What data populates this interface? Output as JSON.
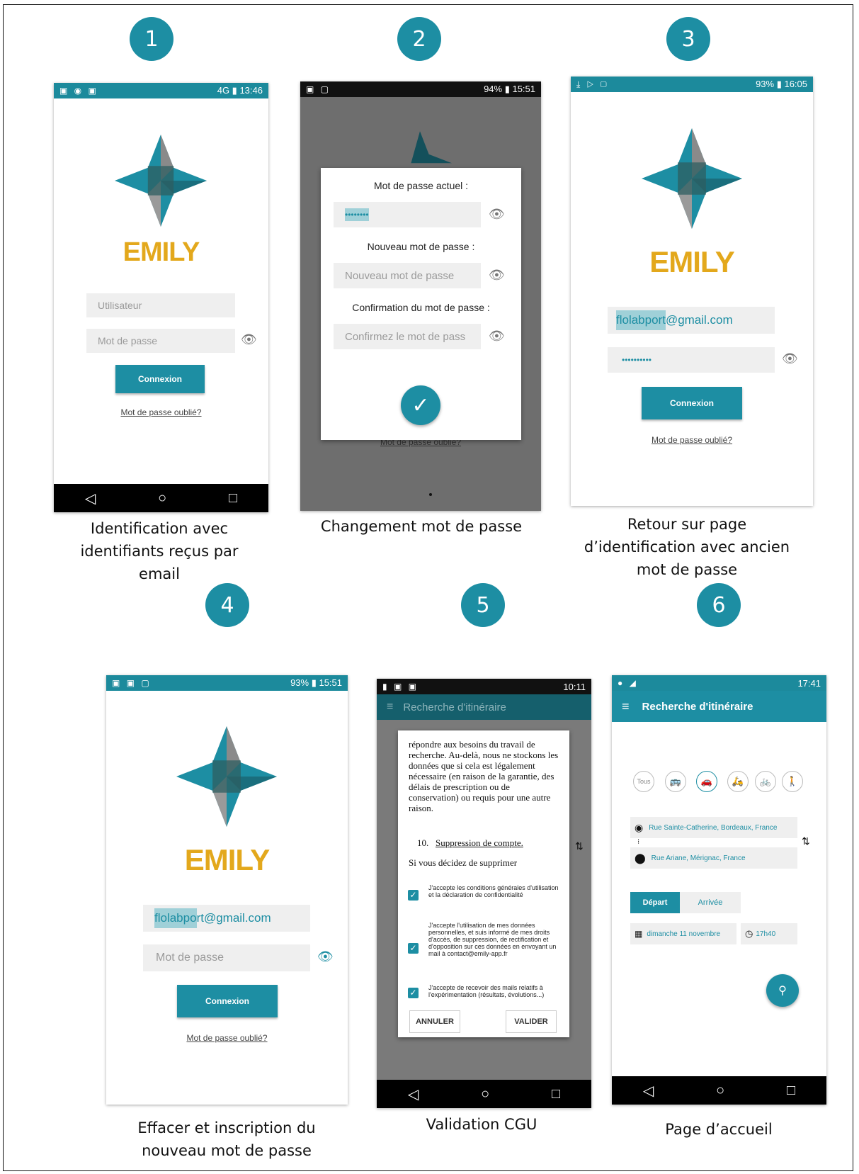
{
  "steps": [
    {
      "number": "1",
      "caption_lines": [
        "Identification avec",
        "identifiants reçus par",
        "email"
      ]
    },
    {
      "number": "2",
      "caption_lines": [
        "Changement mot de passe"
      ]
    },
    {
      "number": "3",
      "caption_lines": [
        "Retour sur page",
        "d’identification avec ancien",
        "mot de passe"
      ]
    },
    {
      "number": "4",
      "caption_lines": [
        "Effacer et inscription du",
        "nouveau mot de passe"
      ]
    },
    {
      "number": "5",
      "caption_lines": [
        "Validation CGU"
      ]
    },
    {
      "number": "6",
      "caption_lines": [
        "Page d’accueil"
      ]
    }
  ],
  "phone1": {
    "time": "13:46",
    "status_right": "4G ▮",
    "logo": "EMILY",
    "user_placeholder": "Utilisateur",
    "pass_placeholder": "Mot de passe",
    "login": "Connexion",
    "forgot": "Mot de passe oublié?"
  },
  "phone2": {
    "status": "94% ▮ 15:51",
    "current_label": "Mot de passe actuel :",
    "current_value": "••••••••",
    "new_label": "Nouveau mot de passe :",
    "new_placeholder": "Nouveau mot de passe",
    "confirm_label": "Confirmation du mot de passe :",
    "confirm_placeholder": "Confirmez le mot de pass",
    "forgot_behind": "Mot de passe oublié?"
  },
  "phone3": {
    "status": "93% ▮ 16:05",
    "logo": "EMILY",
    "email_hl": "flolabport",
    "email_rest": "@gmail.com",
    "password": "••••••••••",
    "login": "Connexion",
    "forgot": "Mot de passe oublié?"
  },
  "phone4": {
    "status": "93% ▮ 15:51",
    "logo": "EMILY",
    "email_hl": "flolabpo",
    "email_rest": "rt@gmail.com",
    "pass_placeholder": "Mot de passe",
    "login": "Connexion",
    "forgot": "Mot de passe oublié?"
  },
  "phone5": {
    "time": "10:11",
    "app_title": "Recherche d'itinéraire",
    "cgu_text": "répondre aux besoins du travail de recherche. Au-delà, nous ne stockons les données que si cela est légalement nécessaire (en raison de la garantie, des délais de prescription ou de conservation) ou requis pour une autre raison.",
    "section_num": "10.",
    "section_title": "Suppression de compte.",
    "cgu_more": "Si vous décidez de supprimer",
    "check1": "J'accepte les conditions générales d'utilisation et la déclaration de confidentialité",
    "check2": "J'accepte l'utilisation de mes données personnelles, et suis informé de mes droits d'accès, de suppression, de rectification et d'opposition sur ces données en envoyant un mail à contact@emily-app.fr",
    "check3": "J'accepte de recevoir des mails relatifs à l'expérimentation (résultats, évolutions...)",
    "cancel": "ANNULER",
    "validate": "VALIDER"
  },
  "phone6": {
    "time": "17:41",
    "app_title": "Recherche d'itinéraire",
    "mode_all": "Tous",
    "from": "Rue Sainte-Catherine, Bordeaux, France",
    "to": "Rue Ariane, Mérignac, France",
    "depart": "Départ",
    "arrive": "Arrivée",
    "date": "dimanche 11 novembre",
    "hour": "17h40"
  },
  "colors": {
    "teal": "#1d8ea3",
    "gold": "#e3a81c"
  }
}
